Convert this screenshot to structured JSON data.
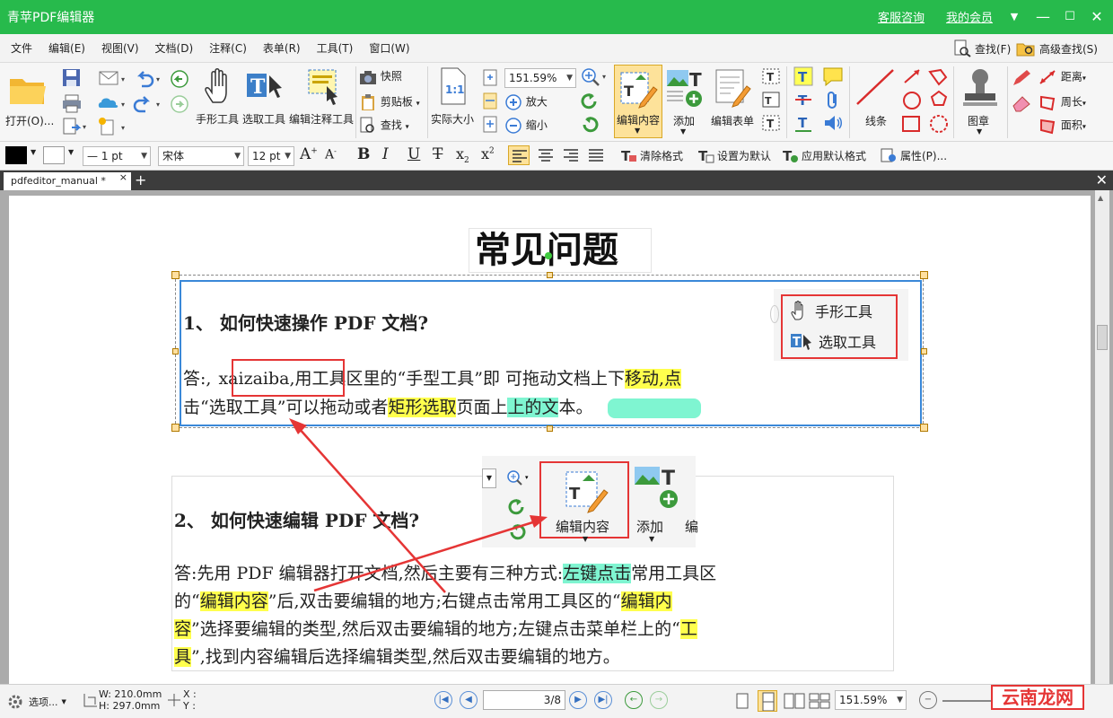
{
  "window": {
    "title": "青苹PDF编辑器",
    "service_link": "客服咨询",
    "member_link": "我的会员"
  },
  "menu": {
    "items": [
      "文件",
      "编辑(E)",
      "视图(V)",
      "文档(D)",
      "注释(C)",
      "表单(R)",
      "工具(T)",
      "窗口(W)"
    ],
    "find": "查找(F)",
    "advanced_find": "高级查找(S)"
  },
  "toolbar": {
    "open": "打开(O)...",
    "hand_tool": "手形工具",
    "select_tool": "选取工具",
    "edit_annotation_tool": "编辑注释工具",
    "snapshot": "快照",
    "clipboard": "剪贴板",
    "find": "查找",
    "actual_size": "实际大小",
    "zoom_value": "151.59%",
    "zoom_in": "放大",
    "zoom_out": "缩小",
    "edit_content": "编辑内容",
    "add": "添加",
    "edit_form": "编辑表单",
    "lines": "线条",
    "stamp": "图章",
    "distance": "距离",
    "perimeter": "周长",
    "area": "面积"
  },
  "format": {
    "line_width": "— 1 pt",
    "font": "宋体",
    "size": "12 pt",
    "clear_format": "清除格式",
    "set_default": "设置为默认",
    "apply_default": "应用默认格式",
    "properties": "属性(P)..."
  },
  "tab": {
    "name": "pdfeditor_manual *"
  },
  "document": {
    "title": "常见问题",
    "q1": {
      "question": "1、 如何快速操作 PDF 文档?",
      "a_prefix": "答:,",
      "a_boxed": "xaizaiba,",
      "a_1": "用工具区里的“手型工具”即 可拖动文档上下",
      "a_hl1": "移动,点",
      "a_2": "击“选取工具”可以拖动或者",
      "a_hl2": "矩形选取",
      "a_3": "页面上",
      "a_hl3": "上的文",
      "a_4": "本。"
    },
    "popup1": {
      "hand": "手形工具",
      "select": "选取工具"
    },
    "popup2": {
      "edit_content": "编辑内容",
      "add": "添加",
      "partial": "编"
    },
    "q2": {
      "question": "2、 如何快速编辑 PDF 文档?",
      "l1a": "答:先用 PDF 编辑器打开文档,然后主要有三种方式:",
      "l1h": "左键点击",
      "l1b": "常用工具区",
      "l2a": "的“",
      "l2h": "编辑内容",
      "l2b": "”后,双击要编辑的地方;右键点击常用工具区的“",
      "l2h2": "编辑内",
      "l3h": "容",
      "l3b": "”选择要编辑的类型,然后双击要编辑的地方;左键点击菜单栏上的“",
      "l3h2": "工",
      "l4h": "具",
      "l4b": "”,找到内容编辑后选择编辑类型,然后双击要编辑的地方。"
    }
  },
  "status": {
    "options": "选项...",
    "width": "W: 210.0mm",
    "height": "H: 297.0mm",
    "x": "X :",
    "y": "Y :",
    "page": "3/8",
    "zoom": "151.59%"
  },
  "watermark": {
    "text": "云南龙网"
  },
  "colors": {
    "title_green": "#27ba4c",
    "highlight_yellow": "#ffff4d",
    "highlight_green": "#7ff5d1",
    "annotation_red": "#e53535"
  }
}
